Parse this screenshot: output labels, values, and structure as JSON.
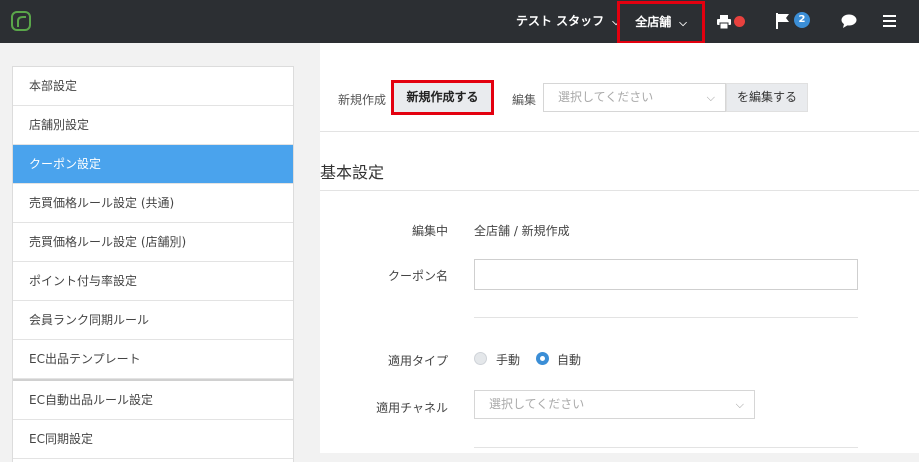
{
  "header": {
    "staff_name": "テスト スタッフ",
    "store_selector": "全店舗",
    "notification_count": "2",
    "alert_color": "#e8413e",
    "badge_color": "#3b8ed6"
  },
  "sidebar": {
    "items": [
      {
        "label": "本部設定"
      },
      {
        "label": "店舗別設定"
      },
      {
        "label": "クーポン設定",
        "active": true
      },
      {
        "label": "売買価格ルール設定 (共通)"
      },
      {
        "label": "売買価格ルール設定 (店舗別)"
      },
      {
        "label": "ポイント付与率設定"
      },
      {
        "label": "会員ランク同期ルール"
      },
      {
        "label": "EC出品テンプレート"
      },
      {
        "label": "EC自動出品ルール設定"
      },
      {
        "label": "EC同期設定"
      }
    ]
  },
  "toolbar": {
    "new_label": "新規作成",
    "new_button": "新規作成する",
    "edit_label": "編集",
    "select_placeholder": "選択してください",
    "edit_button": "を編集する"
  },
  "form": {
    "section_title": "基本設定",
    "editing_label": "編集中",
    "editing_value": "全店舗 / 新規作成",
    "coupon_name_label": "クーポン名",
    "coupon_name_value": "",
    "type_label": "適用タイプ",
    "type_options": [
      "手動",
      "自動"
    ],
    "type_selected": "自動",
    "channel_label": "適用チャネル",
    "channel_placeholder": "選択してください"
  }
}
